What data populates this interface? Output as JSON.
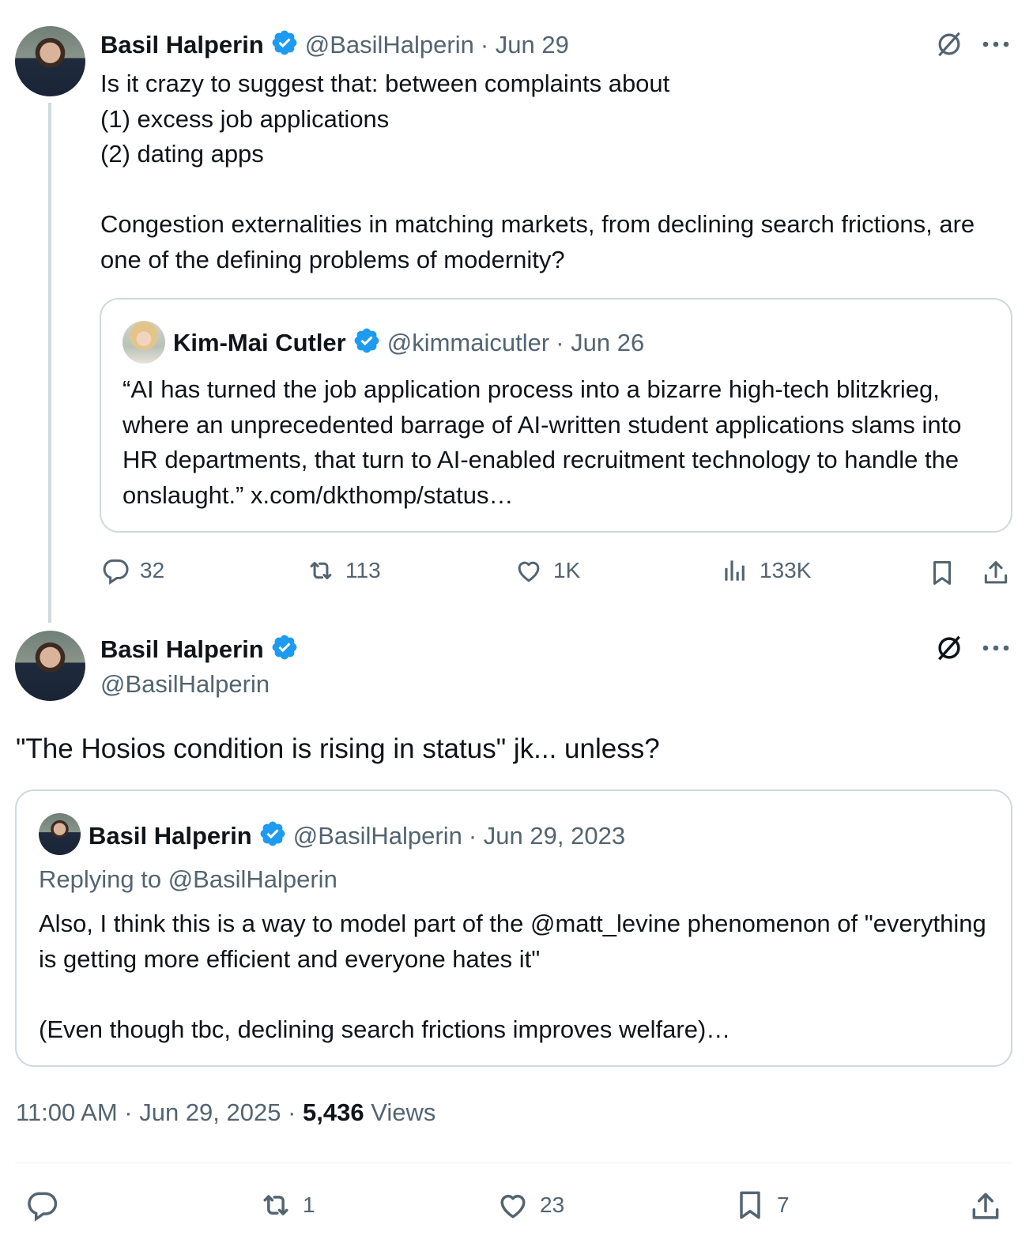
{
  "colors": {
    "verified": "#1d9bf0",
    "secondary_text": "#536471",
    "border": "#cfd9de"
  },
  "tweet1": {
    "author_name": "Basil Halperin",
    "handle": "@BasilHalperin",
    "date": "· Jun 29",
    "text": "Is it crazy to suggest that: between complaints about\n(1) excess job applications\n(2) dating apps\n\nCongestion externalities in matching markets, from declining search frictions, are one of the defining problems of modernity?",
    "quote": {
      "author_name": "Kim-Mai Cutler",
      "handle": "@kimmaicutler",
      "date": "· Jun 26",
      "text": "“AI has turned the job application process into a bizarre high-tech blitzkrieg, where an unprecedented barrage of AI-written student applications slams into HR departments, that turn to AI-enabled recruitment technology to handle the onslaught.” x.com/dkthomp/status…"
    },
    "actions": {
      "replies": "32",
      "reposts": "113",
      "likes": "1K",
      "views": "133K"
    }
  },
  "tweet2": {
    "author_name": "Basil Halperin",
    "handle": "@BasilHalperin",
    "text": "\"The Hosios condition is rising in status\" jk... unless?",
    "quote": {
      "author_name": "Basil Halperin",
      "handle": "@BasilHalperin",
      "date": "· Jun 29, 2023",
      "replying_to": "Replying to @BasilHalperin",
      "text": "Also, I think this is a way to model part of the @matt_levine phenomenon of \"everything is getting more efficient and everyone hates it\"\n\n(Even though tbc, declining search frictions improves welfare)…"
    },
    "timestamp": "11:00 AM · Jun 29, 2025 · ",
    "views_count": "5,436",
    "views_label": " Views",
    "actions": {
      "replies": "",
      "reposts": "1",
      "likes": "23",
      "bookmarks": "7"
    }
  },
  "icons": [
    "grok-icon",
    "more-icon",
    "reply-icon",
    "repost-icon",
    "like-icon",
    "views-icon",
    "bookmark-icon",
    "share-icon",
    "verified-badge-icon"
  ]
}
